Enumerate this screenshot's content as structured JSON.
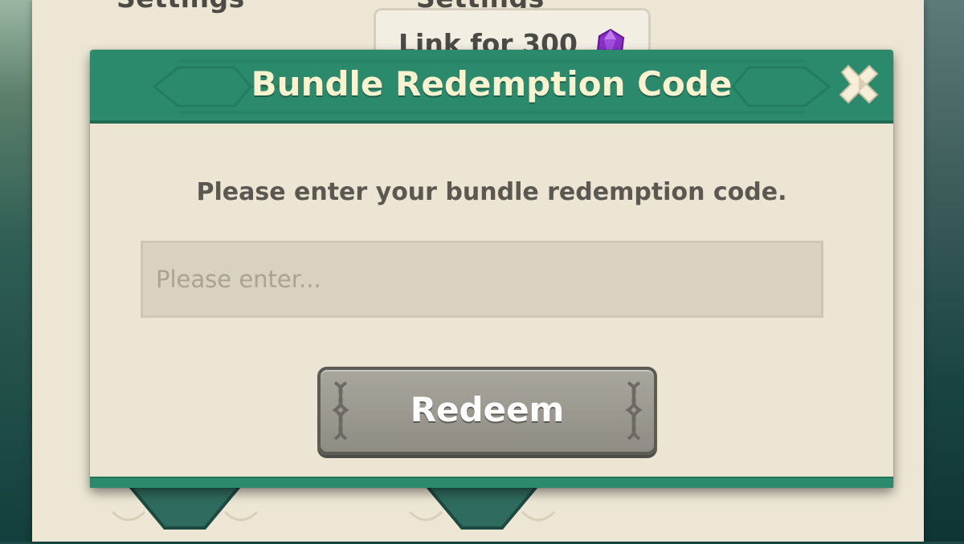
{
  "background": {
    "left_heading": "Settings",
    "right_heading": "Settings",
    "link_button_label": "Link for 300",
    "link_button_icon": "purple-gem-icon"
  },
  "dialog": {
    "title": "Bundle Redemption Code",
    "close_icon": "close-x-icon",
    "prompt": "Please enter your bundle redemption code.",
    "input": {
      "value": "",
      "placeholder": "Please enter..."
    },
    "redeem_label": "Redeem"
  },
  "colors": {
    "header_green": "#2b8a6c",
    "title_cream": "#fbf3cf",
    "panel_cream": "#ece5d3",
    "button_gray": "#9a978f",
    "gem_purple": "#8b2fc9"
  }
}
